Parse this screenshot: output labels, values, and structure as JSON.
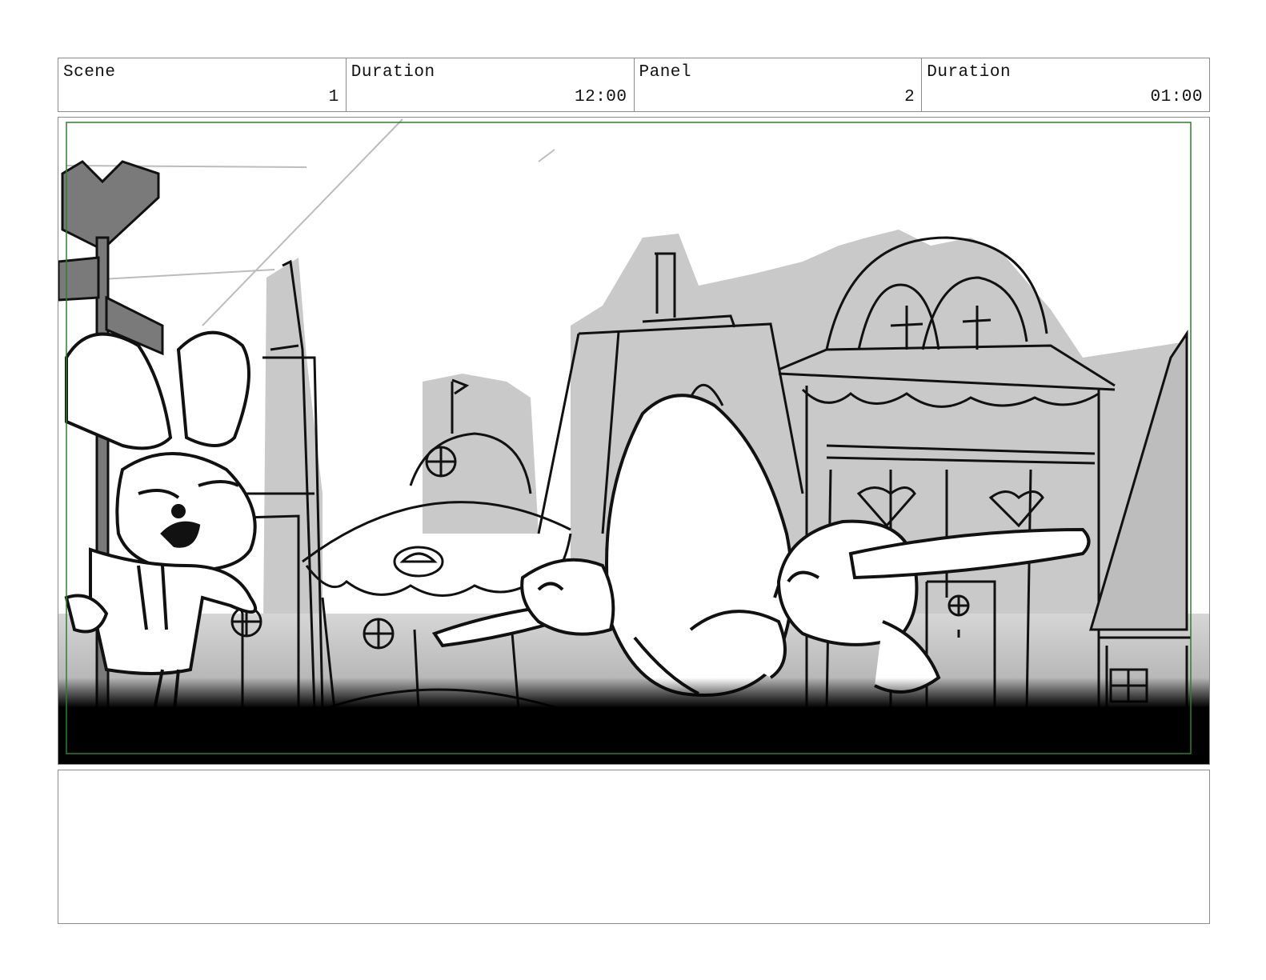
{
  "header": {
    "scene_label": "Scene",
    "scene_value": "1",
    "scene_duration_label": "Duration",
    "scene_duration_value": "12:00",
    "panel_label": "Panel",
    "panel_value": "2",
    "panel_duration_label": "Duration",
    "panel_duration_value": "01:00"
  },
  "panel": {
    "safe_frame_color": "#2e7d32"
  },
  "notes": {
    "text": ""
  }
}
